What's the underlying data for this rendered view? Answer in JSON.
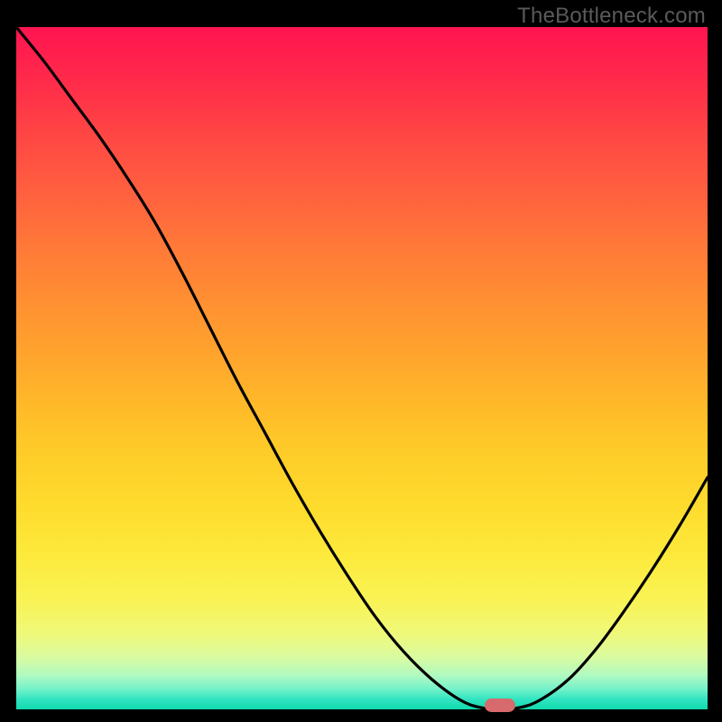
{
  "watermark": "TheBottleneck.com",
  "colors": {
    "frame": "#000000",
    "curve": "#000000",
    "marker": "#d76a6c",
    "gradient_top": "#ff1450",
    "gradient_bottom": "#0fdaad"
  },
  "chart_data": {
    "type": "line",
    "title": "",
    "xlabel": "",
    "ylabel": "",
    "xlim": [
      0,
      100
    ],
    "ylim": [
      0,
      100
    ],
    "x": [
      0,
      4,
      8,
      12,
      16,
      20,
      24,
      28,
      32,
      36,
      40,
      44,
      48,
      52,
      56,
      60,
      64,
      67,
      70,
      73,
      76,
      80,
      84,
      88,
      92,
      96,
      100
    ],
    "values": [
      100,
      95,
      89.5,
      84,
      78,
      71.5,
      64,
      56,
      48,
      40.5,
      33,
      26,
      19.5,
      13.5,
      8.5,
      4.5,
      1.5,
      0.3,
      0,
      0.3,
      1.5,
      4.5,
      9,
      14.5,
      20.5,
      27,
      34
    ],
    "marker_point": {
      "x": 70,
      "y": 0
    }
  }
}
